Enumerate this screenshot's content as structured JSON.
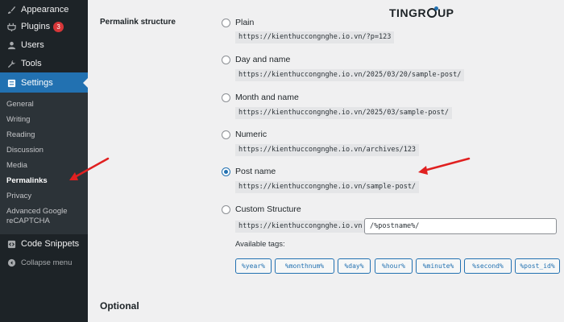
{
  "sidebar": {
    "menu": [
      {
        "label": "Appearance",
        "icon": "paintbrush-icon"
      },
      {
        "label": "Plugins",
        "icon": "plugin-icon",
        "badge": "3"
      },
      {
        "label": "Users",
        "icon": "users-icon"
      },
      {
        "label": "Tools",
        "icon": "wrench-icon"
      },
      {
        "label": "Settings",
        "icon": "settings-icon",
        "active": true
      }
    ],
    "submenu": [
      "General",
      "Writing",
      "Reading",
      "Discussion",
      "Media",
      "Permalinks",
      "Privacy",
      "Advanced Google reCAPTCHA"
    ],
    "current_submenu": "Permalinks",
    "code_snippets": "Code Snippets",
    "collapse": "Collapse menu"
  },
  "main": {
    "section_label": "Permalink structure",
    "options": [
      {
        "label": "Plain",
        "url": "https://kienthuccongnghe.io.vn/?p=123",
        "checked": false
      },
      {
        "label": "Day and name",
        "url": "https://kienthuccongnghe.io.vn/2025/03/20/sample-post/",
        "checked": false
      },
      {
        "label": "Month and name",
        "url": "https://kienthuccongnghe.io.vn/2025/03/sample-post/",
        "checked": false
      },
      {
        "label": "Numeric",
        "url": "https://kienthuccongnghe.io.vn/archives/123",
        "checked": false
      },
      {
        "label": "Post name",
        "url": "https://kienthuccongnghe.io.vn/sample-post/",
        "checked": true
      },
      {
        "label": "Custom Structure",
        "url": "https://kienthuccongnghe.io.vn",
        "checked": false
      }
    ],
    "custom_value": "/%postname%/",
    "available_tags_label": "Available tags:",
    "tags": [
      "%year%",
      "%monthnum%",
      "%day%",
      "%hour%",
      "%minute%",
      "%second%",
      "%post_id%"
    ],
    "optional_heading": "Optional"
  },
  "logo": {
    "text_before": "TIN",
    "text_after": "GR",
    "text_end": "UP"
  },
  "colors": {
    "accent": "#2271b1",
    "sidebar": "#1d2327",
    "annotation": "#e02020"
  }
}
